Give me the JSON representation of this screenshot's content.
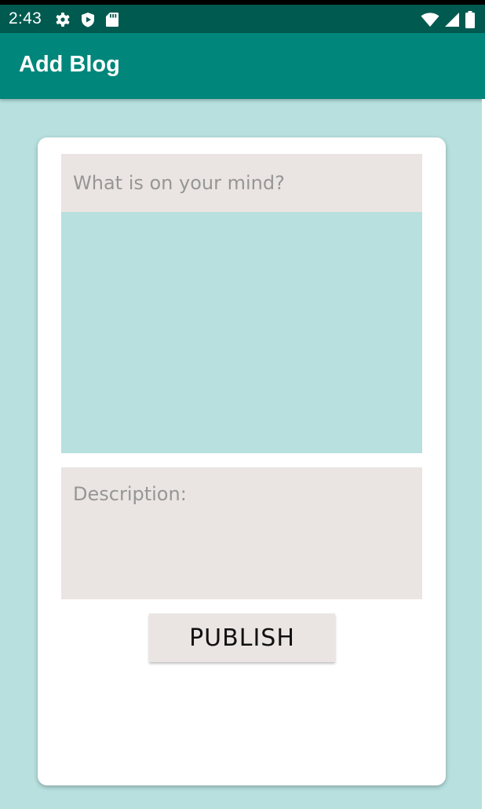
{
  "status_bar": {
    "time": "2:43",
    "left_icons": [
      "gear-icon",
      "play-protect-icon",
      "sd-card-icon"
    ],
    "right_icons": [
      "wifi-icon",
      "cell-signal-icon",
      "battery-icon"
    ]
  },
  "app_bar": {
    "title": "Add Blog"
  },
  "form": {
    "title_placeholder": "What is on your mind?",
    "description_placeholder": "Description:",
    "publish_label": "PUBLISH"
  },
  "colors": {
    "status_bar": "#005a4f",
    "app_bar": "#00867a",
    "background": "#b7e0df",
    "card": "#ffffff",
    "field": "#eae5e3",
    "placeholder_text": "#969696"
  }
}
